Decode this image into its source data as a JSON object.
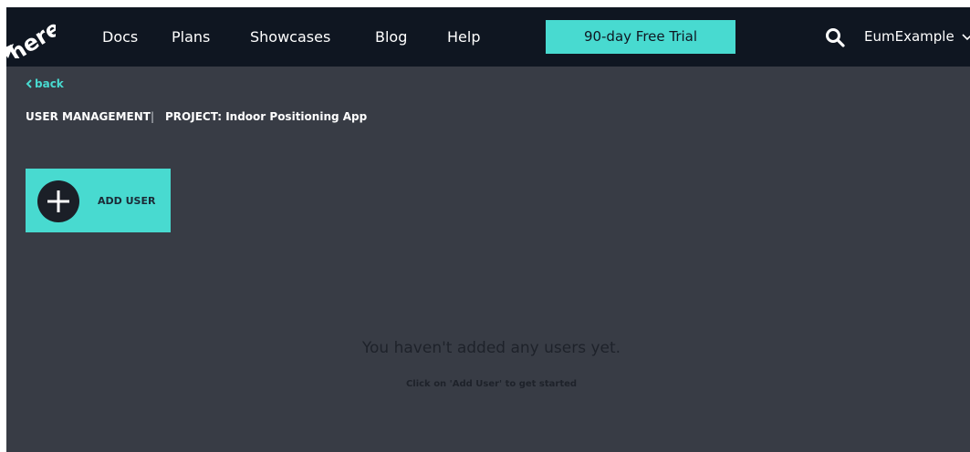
{
  "header": {
    "nav": [
      "Docs",
      "Plans",
      "Showcases",
      "Blog",
      "Help"
    ],
    "trial_label": "90-day Free Trial",
    "search_icon": "search-icon",
    "user_name": "EumExample",
    "user_menu_icon": "chevron-down-icon"
  },
  "page": {
    "back_label": "back",
    "breadcrumb_section": "USER MANAGEMENT",
    "breadcrumb_separator": "|",
    "breadcrumb_project": "PROJECT: Indoor Positioning App",
    "add_user_label": "ADD USER",
    "add_user_icon": "plus-icon",
    "empty_title": "You haven't added any users yet.",
    "empty_subtitle": "Click on 'Add User' to get started"
  },
  "colors": {
    "topbar": "#0f1621",
    "page_background": "#383c45",
    "accent": "#48dad0"
  }
}
